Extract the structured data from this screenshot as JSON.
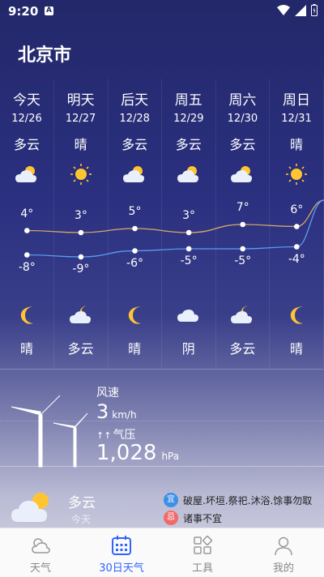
{
  "status": {
    "time": "9:20",
    "badge": "A"
  },
  "city": "北京市",
  "forecast": [
    {
      "day": "今天",
      "date": "12/26",
      "day_condition": "多云",
      "day_icon": "partly-cloudy-day-icon",
      "high": "4°",
      "low": "-8°",
      "night_icon": "moon-icon",
      "night_condition": "晴"
    },
    {
      "day": "明天",
      "date": "12/27",
      "day_condition": "晴",
      "day_icon": "sun-icon",
      "high": "3°",
      "low": "-9°",
      "night_icon": "partly-cloudy-night-icon",
      "night_condition": "多云"
    },
    {
      "day": "后天",
      "date": "12/28",
      "day_condition": "多云",
      "day_icon": "partly-cloudy-day-icon",
      "high": "5°",
      "low": "-6°",
      "night_icon": "moon-icon",
      "night_condition": "晴"
    },
    {
      "day": "周五",
      "date": "12/29",
      "day_condition": "多云",
      "day_icon": "partly-cloudy-day-icon",
      "high": "3°",
      "low": "-5°",
      "night_icon": "cloud-icon",
      "night_condition": "阴"
    },
    {
      "day": "周六",
      "date": "12/30",
      "day_condition": "多云",
      "day_icon": "partly-cloudy-day-icon",
      "high": "7°",
      "low": "-5°",
      "night_icon": "partly-cloudy-night-icon",
      "night_condition": "多云"
    },
    {
      "day": "周日",
      "date": "12/31",
      "day_condition": "晴",
      "day_icon": "sun-icon",
      "high": "6°",
      "low": "-4°",
      "night_icon": "moon-icon",
      "night_condition": "晴"
    }
  ],
  "wind": {
    "label": "风速",
    "value": "3",
    "unit": "km/h"
  },
  "pressure": {
    "label": "气压",
    "value": "1,028",
    "unit": "hPa"
  },
  "today": {
    "condition": "多云",
    "sub": "今天"
  },
  "almanac": {
    "yi_badge": "宜",
    "yi_text": "破屋.坏垣.祭祀.沐浴.馀事勿取",
    "ji_badge": "忌",
    "ji_text": "诸事不宜"
  },
  "tabs": [
    {
      "label": "天气",
      "icon": "weather-tab-icon",
      "active": false
    },
    {
      "label": "30日天气",
      "icon": "calendar-tab-icon",
      "active": true
    },
    {
      "label": "工具",
      "icon": "tools-tab-icon",
      "active": false
    },
    {
      "label": "我的",
      "icon": "profile-tab-icon",
      "active": false
    }
  ],
  "colors": {
    "accent": "#2f64ff",
    "yi": "#3d8fe6",
    "ji": "#f06a6a",
    "sun": "#ffc531"
  }
}
